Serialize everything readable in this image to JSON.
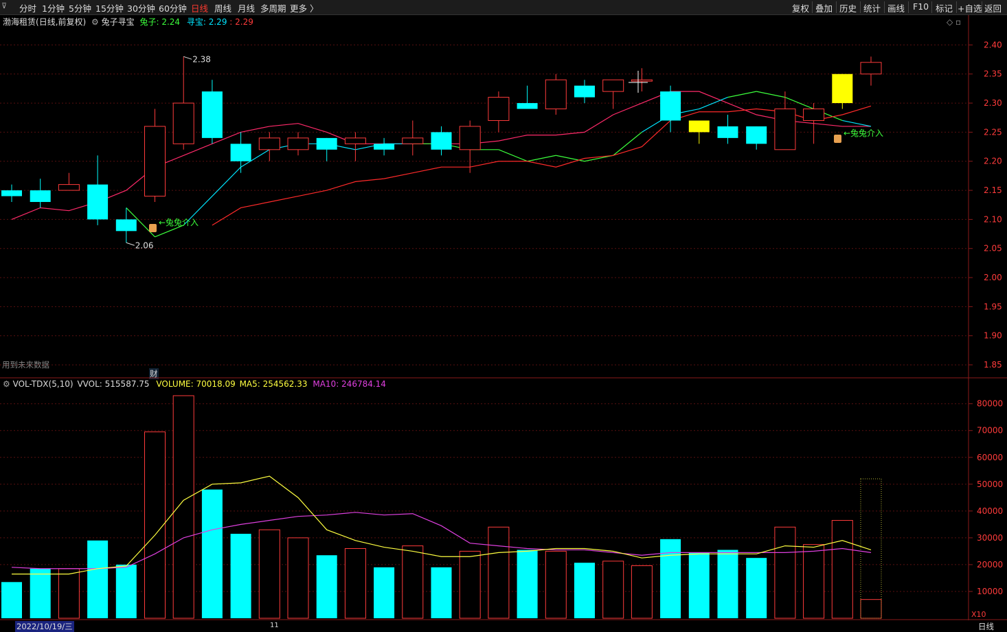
{
  "toolbar": {
    "periods": [
      "分时",
      "1分钟",
      "5分钟",
      "15分钟",
      "30分钟",
      "60分钟",
      "日线",
      "周线",
      "月线",
      "多周期",
      "更多 〉"
    ],
    "active_period": "日线",
    "right_buttons": [
      "复权",
      "叠加",
      "历史",
      "统计",
      "画线",
      "F10",
      "标记",
      "+自选",
      "返回"
    ],
    "left_icon": "restore-icon"
  },
  "price_panel": {
    "stock_name": "渤海租赁",
    "mode": "(日线,前复权)",
    "indicator_name": "兔子寻宝",
    "ind1_label": "兔子: 2.24",
    "ind2_label": "寻宝: 2.29",
    "ind3_label": "2.29",
    "future_note": "用到未来数据",
    "marker_cai": "财",
    "annot_high": "2.38",
    "annot_low": "2.06",
    "annot_signal": "兔兔介入",
    "y_ticks": [
      "2.40",
      "2.35",
      "2.30",
      "2.25",
      "2.20",
      "2.15",
      "2.10",
      "2.05",
      "2.00",
      "1.95",
      "1.90",
      "1.85"
    ]
  },
  "volume_panel": {
    "title": "VOL-TDX(5,10)",
    "vvol_label": "VVOL: 515587.75",
    "volume_label": "VOLUME: 70018.09",
    "ma5_label": "MA5: 254562.33",
    "ma10_label": "MA10: 246784.14",
    "y_ticks": [
      "80000",
      "70000",
      "60000",
      "50000",
      "40000",
      "30000",
      "20000",
      "10000"
    ],
    "unit": "X10"
  },
  "date_bar": {
    "date": "2022/10/19/三",
    "month_mark": "11",
    "period_label": "日线"
  },
  "colors": {
    "up": "#ff3b3b",
    "down": "#00ffff",
    "highlight": "#ffff00",
    "ma_red": "#ff2a2a",
    "ma_pink": "#ff2a6a",
    "vol_ma5": "#ffff40",
    "vol_ma10": "#e040e0",
    "signal_green": "#3cff3c"
  },
  "chart_data": {
    "type": "candlestick",
    "price": {
      "ylim": [
        1.83,
        2.43
      ],
      "candles": [
        {
          "o": 2.15,
          "c": 2.14,
          "h": 2.16,
          "l": 2.13
        },
        {
          "o": 2.15,
          "c": 2.13,
          "h": 2.17,
          "l": 2.12
        },
        {
          "o": 2.15,
          "c": 2.16,
          "h": 2.18,
          "l": 2.15
        },
        {
          "o": 2.16,
          "c": 2.1,
          "h": 2.21,
          "l": 2.09
        },
        {
          "o": 2.1,
          "c": 2.08,
          "h": 2.12,
          "l": 2.06
        },
        {
          "o": 2.14,
          "c": 2.26,
          "h": 2.29,
          "l": 2.13
        },
        {
          "o": 2.23,
          "c": 2.3,
          "h": 2.38,
          "l": 2.22
        },
        {
          "o": 2.32,
          "c": 2.24,
          "h": 2.34,
          "l": 2.23
        },
        {
          "o": 2.23,
          "c": 2.2,
          "h": 2.25,
          "l": 2.18
        },
        {
          "o": 2.22,
          "c": 2.24,
          "h": 2.25,
          "l": 2.2
        },
        {
          "o": 2.22,
          "c": 2.24,
          "h": 2.25,
          "l": 2.21
        },
        {
          "o": 2.24,
          "c": 2.22,
          "h": 2.24,
          "l": 2.2
        },
        {
          "o": 2.23,
          "c": 2.24,
          "h": 2.25,
          "l": 2.2
        },
        {
          "o": 2.23,
          "c": 2.22,
          "h": 2.24,
          "l": 2.21
        },
        {
          "o": 2.23,
          "c": 2.24,
          "h": 2.27,
          "l": 2.21
        },
        {
          "o": 2.25,
          "c": 2.22,
          "h": 2.26,
          "l": 2.21
        },
        {
          "o": 2.22,
          "c": 2.26,
          "h": 2.27,
          "l": 2.18
        },
        {
          "o": 2.27,
          "c": 2.31,
          "h": 2.32,
          "l": 2.25
        },
        {
          "o": 2.3,
          "c": 2.29,
          "h": 2.33,
          "l": 2.29
        },
        {
          "o": 2.29,
          "c": 2.34,
          "h": 2.35,
          "l": 2.28
        },
        {
          "o": 2.33,
          "c": 2.31,
          "h": 2.34,
          "l": 2.3
        },
        {
          "o": 2.32,
          "c": 2.34,
          "h": 2.34,
          "l": 2.29
        },
        {
          "o": 2.34,
          "c": 2.34,
          "h": 2.36,
          "l": 2.32
        },
        {
          "o": 2.32,
          "c": 2.27,
          "h": 2.33,
          "l": 2.25
        },
        {
          "o": 2.27,
          "c": 2.25,
          "h": 2.27,
          "l": 2.23
        },
        {
          "o": 2.26,
          "c": 2.24,
          "h": 2.28,
          "l": 2.23
        },
        {
          "o": 2.26,
          "c": 2.23,
          "h": 2.26,
          "l": 2.22
        },
        {
          "o": 2.22,
          "c": 2.29,
          "h": 2.32,
          "l": 2.22
        },
        {
          "o": 2.27,
          "c": 2.29,
          "h": 2.3,
          "l": 2.23
        },
        {
          "o": 2.3,
          "c": 2.35,
          "h": 2.35,
          "l": 2.29
        },
        {
          "o": 2.35,
          "c": 2.37,
          "h": 2.38,
          "l": 2.33
        }
      ],
      "highlight_idx": [
        24,
        29
      ],
      "ma_short": [
        null,
        null,
        null,
        null,
        2.12,
        2.07,
        2.09,
        2.14,
        2.19,
        2.22,
        2.23,
        2.23,
        2.22,
        2.23,
        2.23,
        2.23,
        2.22,
        2.22,
        2.2,
        2.21,
        2.2,
        2.21,
        2.25,
        2.28,
        2.29,
        2.31,
        2.32,
        2.31,
        2.29,
        2.27,
        2.26
      ],
      "ma_long": [
        2.1,
        2.12,
        2.115,
        2.13,
        2.15,
        2.19,
        2.21,
        2.23,
        2.25,
        2.26,
        2.265,
        2.25,
        2.23,
        2.23,
        2.23,
        2.23,
        2.23,
        2.235,
        2.245,
        2.245,
        2.25,
        2.28,
        2.3,
        2.32,
        2.32,
        2.3,
        2.28,
        2.27,
        2.265,
        2.26,
        2.26
      ],
      "ma_cont": [
        null,
        null,
        null,
        null,
        null,
        null,
        null,
        2.09,
        2.12,
        2.13,
        2.14,
        2.15,
        2.165,
        2.17,
        2.18,
        2.19,
        2.19,
        2.2,
        2.2,
        2.19,
        2.205,
        2.21,
        2.225,
        2.27,
        2.285,
        2.285,
        2.29,
        2.285,
        2.27,
        2.28,
        2.295
      ]
    },
    "volume": {
      "ylim": [
        0,
        83000
      ],
      "values": [
        13500,
        18500,
        18500,
        29000,
        20000,
        69500,
        83000,
        48000,
        31500,
        33000,
        30000,
        23500,
        26000,
        19000,
        27000,
        19000,
        25000,
        34000,
        25500,
        25000,
        20700,
        21300,
        19600,
        29500,
        24500,
        25500,
        22500,
        34000,
        27500,
        36500,
        7000
      ],
      "future_bar": 52000,
      "ma5": [
        16500,
        16500,
        16500,
        18500,
        19500,
        31000,
        44000,
        50000,
        50500,
        53000,
        45000,
        33000,
        29000,
        26500,
        25000,
        23000,
        23000,
        24500,
        25000,
        26000,
        26000,
        25000,
        22500,
        23500,
        24000,
        24000,
        24000,
        27000,
        26500,
        29000,
        25500
      ],
      "ma10": [
        19000,
        18500,
        18500,
        18500,
        19000,
        24000,
        30000,
        33000,
        35000,
        36500,
        38000,
        38500,
        39500,
        38500,
        39000,
        34500,
        28000,
        27000,
        26000,
        25500,
        25500,
        24500,
        23500,
        24500,
        24500,
        24500,
        24500,
        24500,
        25000,
        26000,
        24500
      ]
    }
  }
}
